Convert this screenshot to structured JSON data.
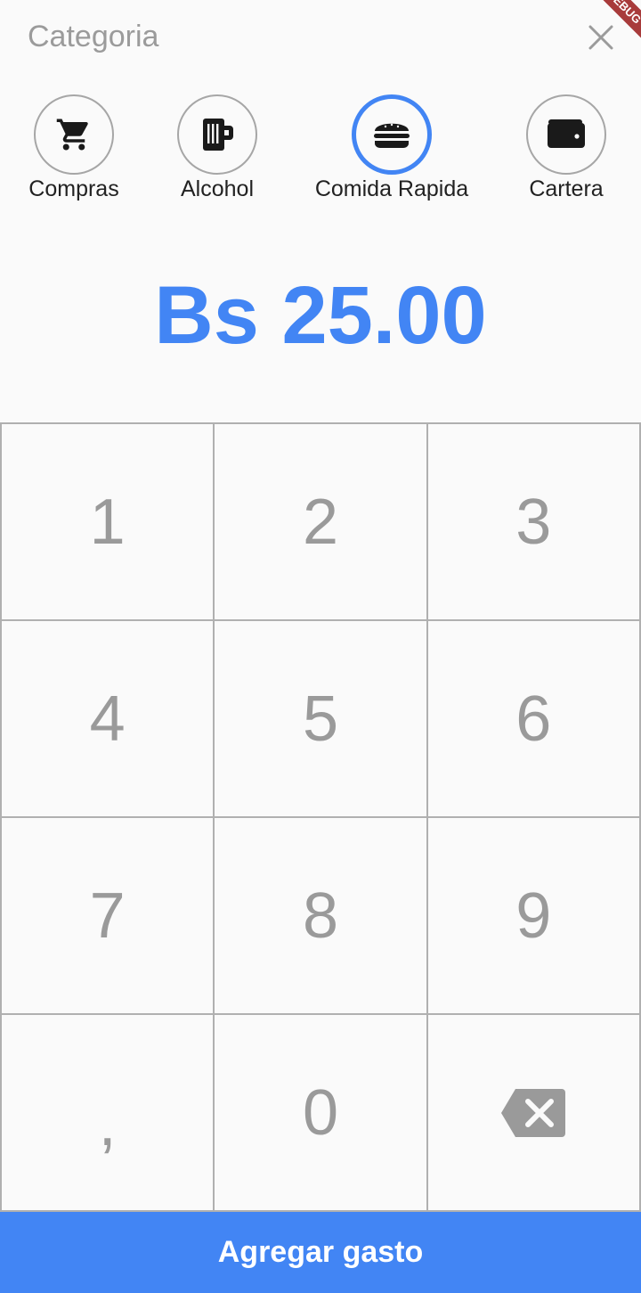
{
  "header": {
    "title": "Categoria",
    "close_icon": "close-icon",
    "debug_banner": "DEBUG"
  },
  "categories": [
    {
      "label": "Compras",
      "icon": "shopping-cart-icon",
      "selected": false
    },
    {
      "label": "Alcohol",
      "icon": "beer-mug-icon",
      "selected": false
    },
    {
      "label": "Comida Rapida",
      "icon": "hamburger-icon",
      "selected": true
    },
    {
      "label": "Cartera",
      "icon": "wallet-icon",
      "selected": false
    }
  ],
  "amount": {
    "display": "Bs 25.00"
  },
  "keypad": {
    "keys": [
      "1",
      "2",
      "3",
      "4",
      "5",
      "6",
      "7",
      "8",
      "9",
      ",",
      "0"
    ],
    "backspace_icon": "backspace-icon"
  },
  "submit": {
    "label": "Agregar gasto"
  },
  "colors": {
    "accent": "#4285f4",
    "title": "#9b9b9b",
    "key_text": "#9a9a9a",
    "grid_line": "#b0b0b0",
    "background": "#fafafa"
  }
}
